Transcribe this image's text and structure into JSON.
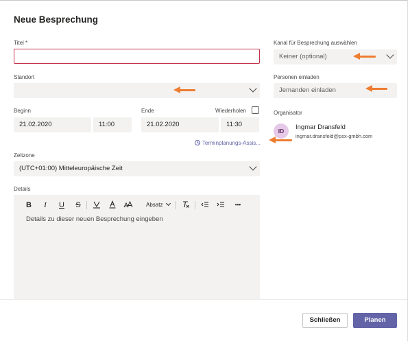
{
  "dialog": {
    "title": "Neue Besprechung"
  },
  "form": {
    "title_label": "Titel *",
    "title_value": "",
    "location_label": "Standort",
    "location_value": "",
    "start_label": "Beginn",
    "start_date": "21.02.2020",
    "start_time": "11:00",
    "end_label": "Ende",
    "end_date": "21.02.2020",
    "end_time": "11:30",
    "repeat_label": "Wiederholen",
    "scheduling_assistant": "Terminplanungs-Assis...",
    "timezone_label": "Zeitzone",
    "timezone_value": "(UTC+01:00) Mitteleuropäische Zeit",
    "details_label": "Details",
    "details_placeholder": "Details zu dieser neuen Besprechung eingeben"
  },
  "toolbar": {
    "bold": "B",
    "italic": "I",
    "underline": "U",
    "strike": "S",
    "paragraph": "Absatz",
    "more": "•••"
  },
  "side": {
    "channel_label": "Kanal für Besprechung auswählen",
    "channel_value": "Keiner (optional)",
    "invite_label": "Personen einladen",
    "invite_placeholder": "Jemanden einladen",
    "organizer_label": "Organisator",
    "organizer_initials": "ID",
    "organizer_name": "Ingmar Dransfeld",
    "organizer_email": "ingmar.dransfeld@psx-gmbh.com"
  },
  "footer": {
    "close_label": "Schließen",
    "plan_label": "Planen"
  },
  "colors": {
    "accent": "#6264a7",
    "error": "#c4314b",
    "annotation_arrow": "#ed7d31",
    "field_bg": "#f3f2f1"
  }
}
